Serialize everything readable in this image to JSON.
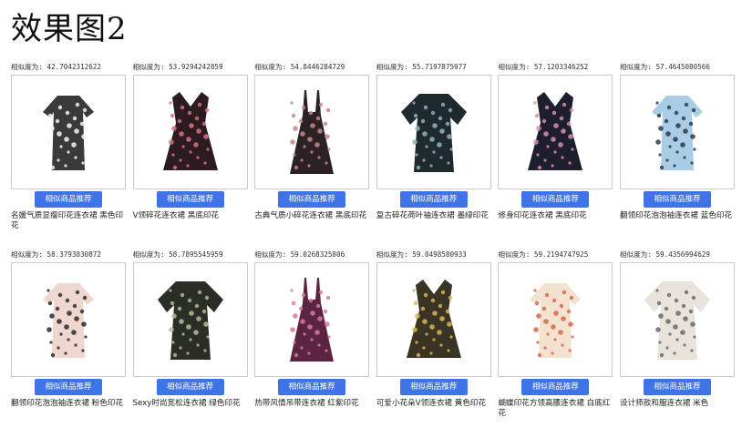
{
  "page": {
    "title": "效果图2"
  },
  "products": [
    {
      "similarity": "相似度为: 42.7042312622",
      "button": "相似商品推荐",
      "name": "名媛气质显瘦印花连衣裙 黑色印花",
      "color": "#3a3a3a",
      "accent": "#f4f4f4",
      "icon": "dress-photo"
    },
    {
      "similarity": "相似度为: 53.9294242859",
      "button": "相似商品推荐",
      "name": "V领碎花连衣裙 黑底印花",
      "color": "#2c1c22",
      "accent": "#d9707c",
      "icon": "dress-photo"
    },
    {
      "similarity": "相似度为: 54.8446284729",
      "button": "相似商品推荐",
      "name": "古典气质小碎花连衣裙 黑底印花",
      "color": "#2b2226",
      "accent": "#c7848a",
      "icon": "dress-photo"
    },
    {
      "similarity": "相似度为: 55.7197875977",
      "button": "相似商品推荐",
      "name": "复古碎花荷叶袖连衣裙 墨绿印花",
      "color": "#1e2a2e",
      "accent": "#8fb4b0",
      "icon": "dress-photo"
    },
    {
      "similarity": "相似度为: 57.1203346252",
      "button": "相似商品推荐",
      "name": "修身印花连衣裙 黑底印花",
      "color": "#1d1f2c",
      "accent": "#d88cb0",
      "icon": "dress-photo"
    },
    {
      "similarity": "相似度为: 57.4645080566",
      "button": "相似商品推荐",
      "name": "翻领印花泡泡袖连衣裙 蓝色印花",
      "color": "#a9cde6",
      "accent": "#2f3a48",
      "icon": "dress-photo"
    },
    {
      "similarity": "相似度为: 58.3793830872",
      "button": "相似商品推荐",
      "name": "翻领印花泡泡袖连衣裙 粉色印花",
      "color": "#efd7d0",
      "accent": "#2a2a2a",
      "icon": "dress-photo"
    },
    {
      "similarity": "相似度为: 58.7895545959",
      "button": "相似商品推荐",
      "name": "Sexy时尚宽松连衣裙 绿色印花",
      "color": "#2a2e26",
      "accent": "#b3b89a",
      "icon": "dress-photo"
    },
    {
      "similarity": "相似度为: 59.0268325806",
      "button": "相似商品推荐",
      "name": "热带风情吊带连衣裙 红紫印花",
      "color": "#5b2440",
      "accent": "#d4799f",
      "icon": "dress-photo"
    },
    {
      "similarity": "相似度为: 59.0498580933",
      "button": "相似商品推荐",
      "name": "可爱小花朵V领连衣裙 黄色印花",
      "color": "#3a3424",
      "accent": "#d9b356",
      "icon": "dress-photo"
    },
    {
      "similarity": "相似度为: 59.2194747925",
      "button": "相似商品推荐",
      "name": "蝴蝶印花方领高腰连衣裙 白底红花",
      "color": "#f3e2cf",
      "accent": "#d46a4a",
      "icon": "dress-photo"
    },
    {
      "similarity": "相似度为: 59.4356994629",
      "button": "相似商品推荐",
      "name": "设计师款和服连衣裙 米色",
      "color": "#e8e4dc",
      "accent": "#6a6a6a",
      "icon": "dress-photo"
    }
  ]
}
